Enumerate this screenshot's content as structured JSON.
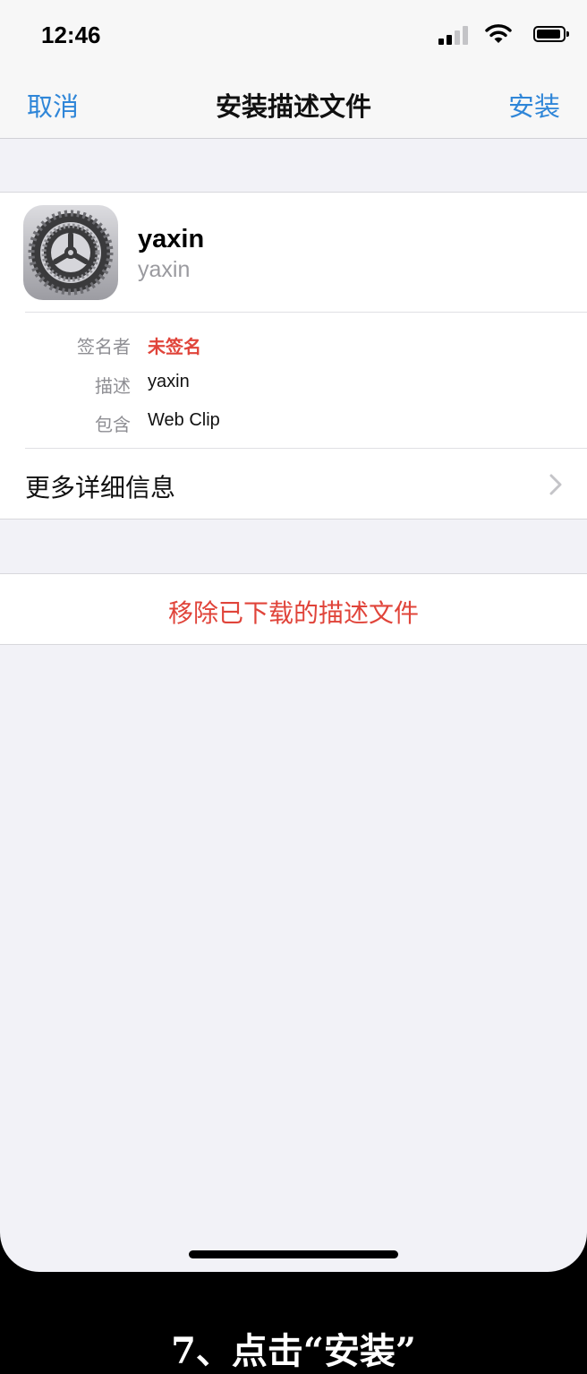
{
  "status_bar": {
    "time": "12:46",
    "icons": [
      "signal-icon",
      "wifi-icon",
      "battery-icon"
    ]
  },
  "nav": {
    "cancel": "取消",
    "title": "安装描述文件",
    "install": "安装"
  },
  "profile": {
    "icon": "settings-gear-icon",
    "name": "yaxin",
    "subname": "yaxin",
    "details": [
      {
        "label": "签名者",
        "value": "未签名"
      },
      {
        "label": "描述",
        "value": "yaxin"
      },
      {
        "label": "包含",
        "value": "Web Clip"
      }
    ],
    "more": "更多详细信息"
  },
  "actions": {
    "remove": "移除已下载的描述文件"
  },
  "caption": "7、点击“安装”",
  "colors": {
    "accent": "#2f86d8",
    "destructive": "#e0443a",
    "background": "#f2f2f7"
  }
}
